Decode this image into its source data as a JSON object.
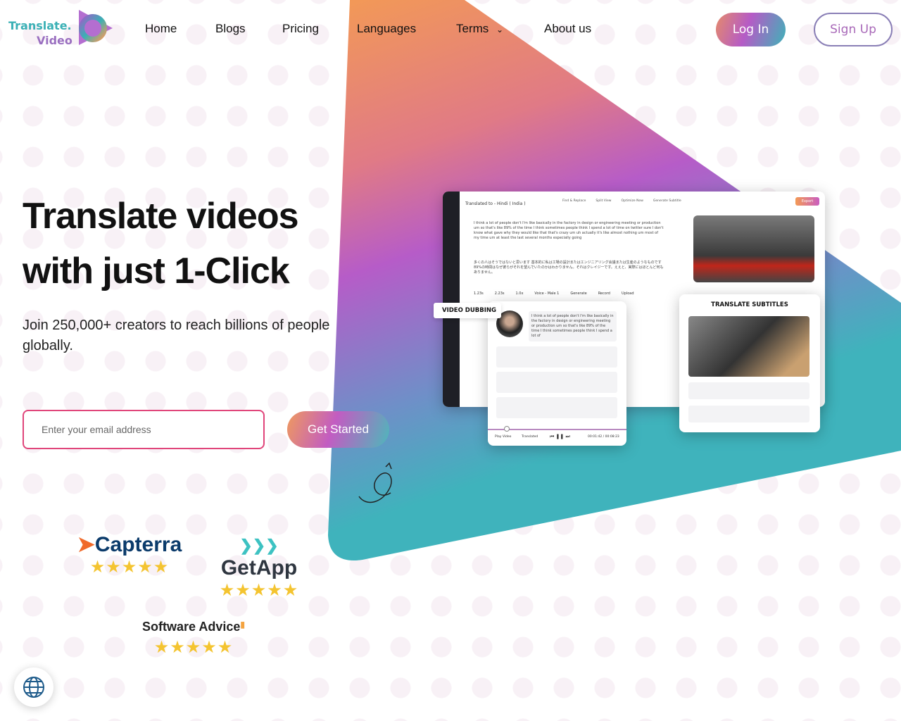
{
  "nav": {
    "logo_line1": "Translate.",
    "logo_line2": "Video",
    "links": [
      "Home",
      "Blogs",
      "Pricing",
      "Languages",
      "Terms",
      "About us"
    ],
    "login": "Log In",
    "signup": "Sign Up"
  },
  "hero": {
    "title_line1": "Translate videos",
    "title_line2": "with just 1-Click",
    "subtitle": "Join 250,000+ creators to reach billions of people globally.",
    "email_placeholder": "Enter your email address",
    "cta": "Get Started"
  },
  "mockup": {
    "translated_to": "Translated to - Hindi ( India )",
    "toolbar": [
      "Find & Replace",
      "Split View",
      "Optimize Now",
      "Generate Subtitle"
    ],
    "export": "Export",
    "english_text": "I think a lot of people don't I'm like basically in the factory in design or engineering meeting or production um so that's like 89% of the time I think sometimes people think I spend a lot of time on twitter sure I don't know what gave why they would like that that's crazy um uh actually it's like almost nothing um most of my time um at least the last several months especially going",
    "japanese_text": "多くの人はそうではないと思います 基本的に私は工場の設計またはエンジニアリング会議または生産のようなものです 89%の時間はなぜ彼らがそれを望んでいたのかはわかりません。それはクレイジーです。ええと、実際にはほとんど何もありません。",
    "controls": [
      "1.23s",
      "2.23s",
      "1.0x",
      "Voice - Male 1",
      "Generate",
      "Record",
      "Upload"
    ],
    "dubbing_label": "VIDEO DUBBING",
    "dubbing_text": "I think a lot of people don't I'm like basically in the factory in design or engineering meeting or production um so that's like 89% of the time I think sometimes people think I spend a lot of",
    "play_video": "Play Video",
    "translated": "Translated",
    "time": "00:01:42 / 00:08:23",
    "subtitles_label": "TRANSLATE SUBTITLES"
  },
  "ratings": [
    {
      "brand": "Capterra",
      "stars": 5
    },
    {
      "brand": "GetApp",
      "stars": 5
    },
    {
      "brand": "Software Advice",
      "stars": 5
    }
  ],
  "colors": {
    "orange": "#f0935a",
    "magenta": "#b65cc8",
    "teal": "#3fb3bc",
    "capterra": "#0b3b6b",
    "email_border": "#e0457a"
  },
  "icons": {
    "globe": "globe-icon",
    "chevron": "chevron-down-icon"
  }
}
